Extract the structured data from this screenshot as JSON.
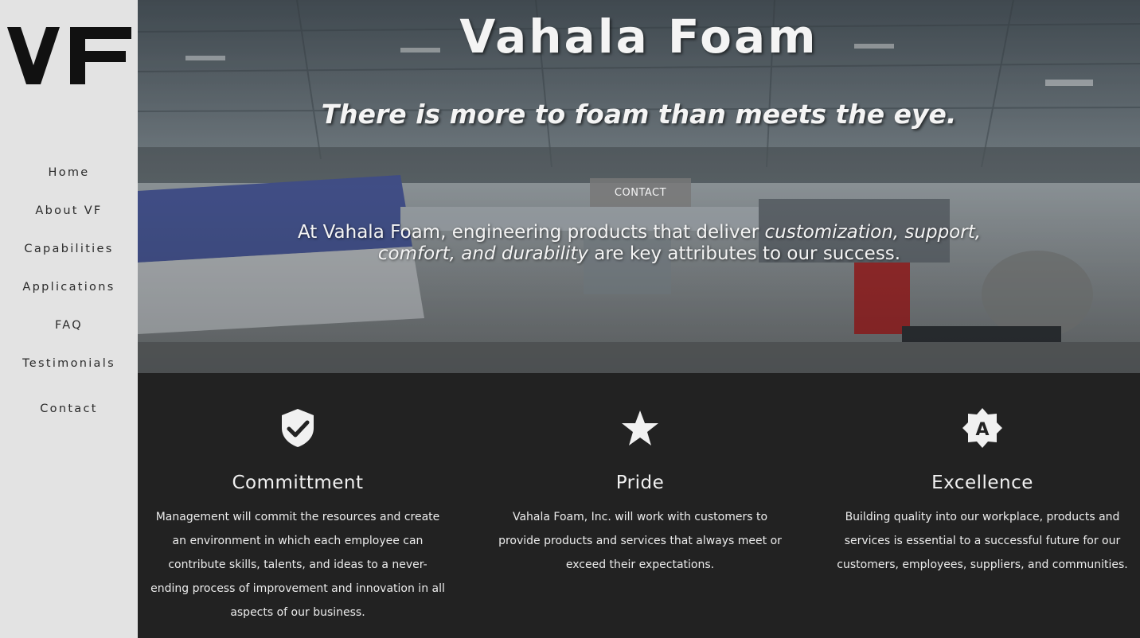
{
  "brand": {
    "logo_text": "VF"
  },
  "nav": {
    "items": [
      "Home",
      "About VF",
      "Capabilities",
      "Applications",
      "FAQ",
      "Testimonials",
      "Contact"
    ]
  },
  "hero": {
    "title": "Vahala Foam",
    "tagline": "There is more to foam than meets the eye.",
    "cta_label": "CONTACT",
    "desc_pre": "At Vahala Foam, engineering products that deliver ",
    "desc_em": "customization, support, comfort, and durability",
    "desc_post": " are key attributes to our success."
  },
  "values": [
    {
      "icon": "shield-check-icon",
      "title": "Committment",
      "text": "Management will commit the resources and create an environment in which each employee can contribute skills, talents, and ideas to a never-ending process of improvement and innovation in all aspects of our business."
    },
    {
      "icon": "star-icon",
      "title": "Pride",
      "text": "Vahala Foam, Inc. will work with customers to provide products and services that always meet or exceed their expectations."
    },
    {
      "icon": "badge-a-icon",
      "title": "Excellence",
      "text": "Building quality into our workplace, products and services is essential to a successful future for our customers, employees, suppliers, and communities."
    }
  ],
  "colors": {
    "sidebar_bg": "#e3e3e3",
    "section_bg": "#222222",
    "text_light": "#f4f4f4"
  }
}
